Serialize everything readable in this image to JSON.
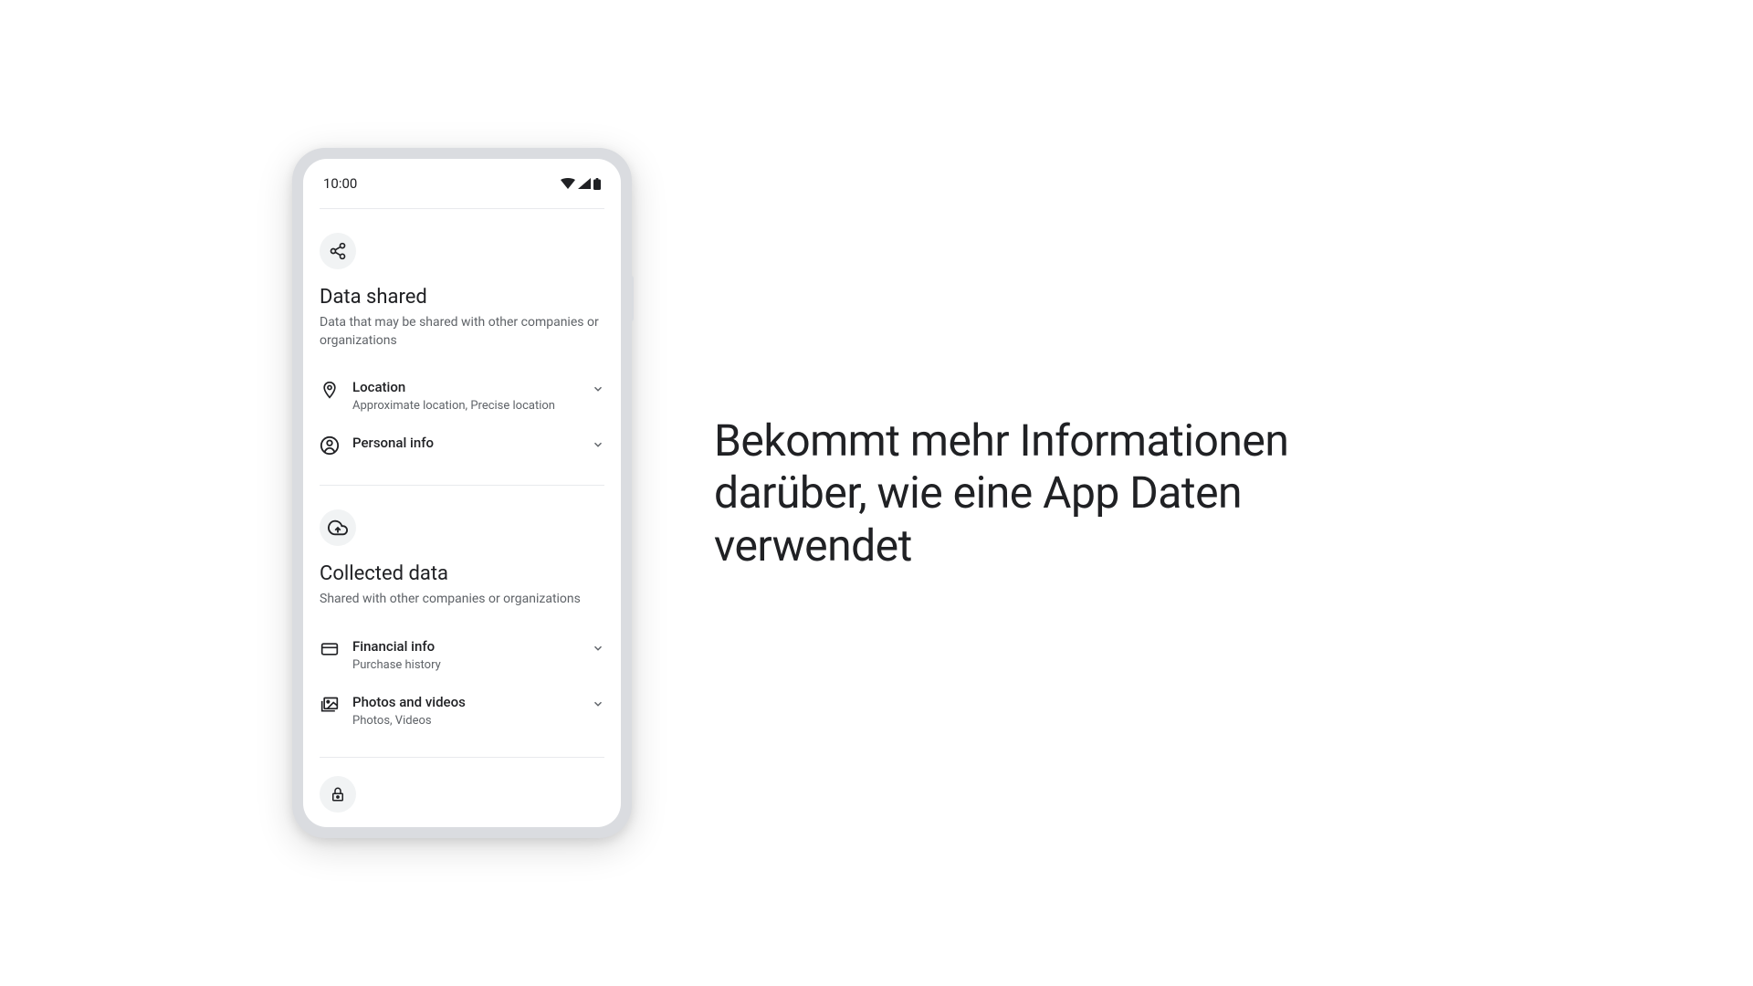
{
  "statusBar": {
    "time": "10:00"
  },
  "sections": {
    "dataShared": {
      "title": "Data shared",
      "subtitle": "Data that may be shared with other companies or organizations",
      "items": [
        {
          "title": "Location",
          "subtitle": "Approximate location, Precise location"
        },
        {
          "title": "Personal info",
          "subtitle": ""
        }
      ]
    },
    "collectedData": {
      "title": "Collected data",
      "subtitle": "Shared with other companies or organizations",
      "items": [
        {
          "title": "Financial info",
          "subtitle": "Purchase history"
        },
        {
          "title": "Photos and videos",
          "subtitle": "Photos, Videos"
        }
      ]
    }
  },
  "headline": "Bekommt mehr Informationen darüber, wie eine App Daten verwendet"
}
